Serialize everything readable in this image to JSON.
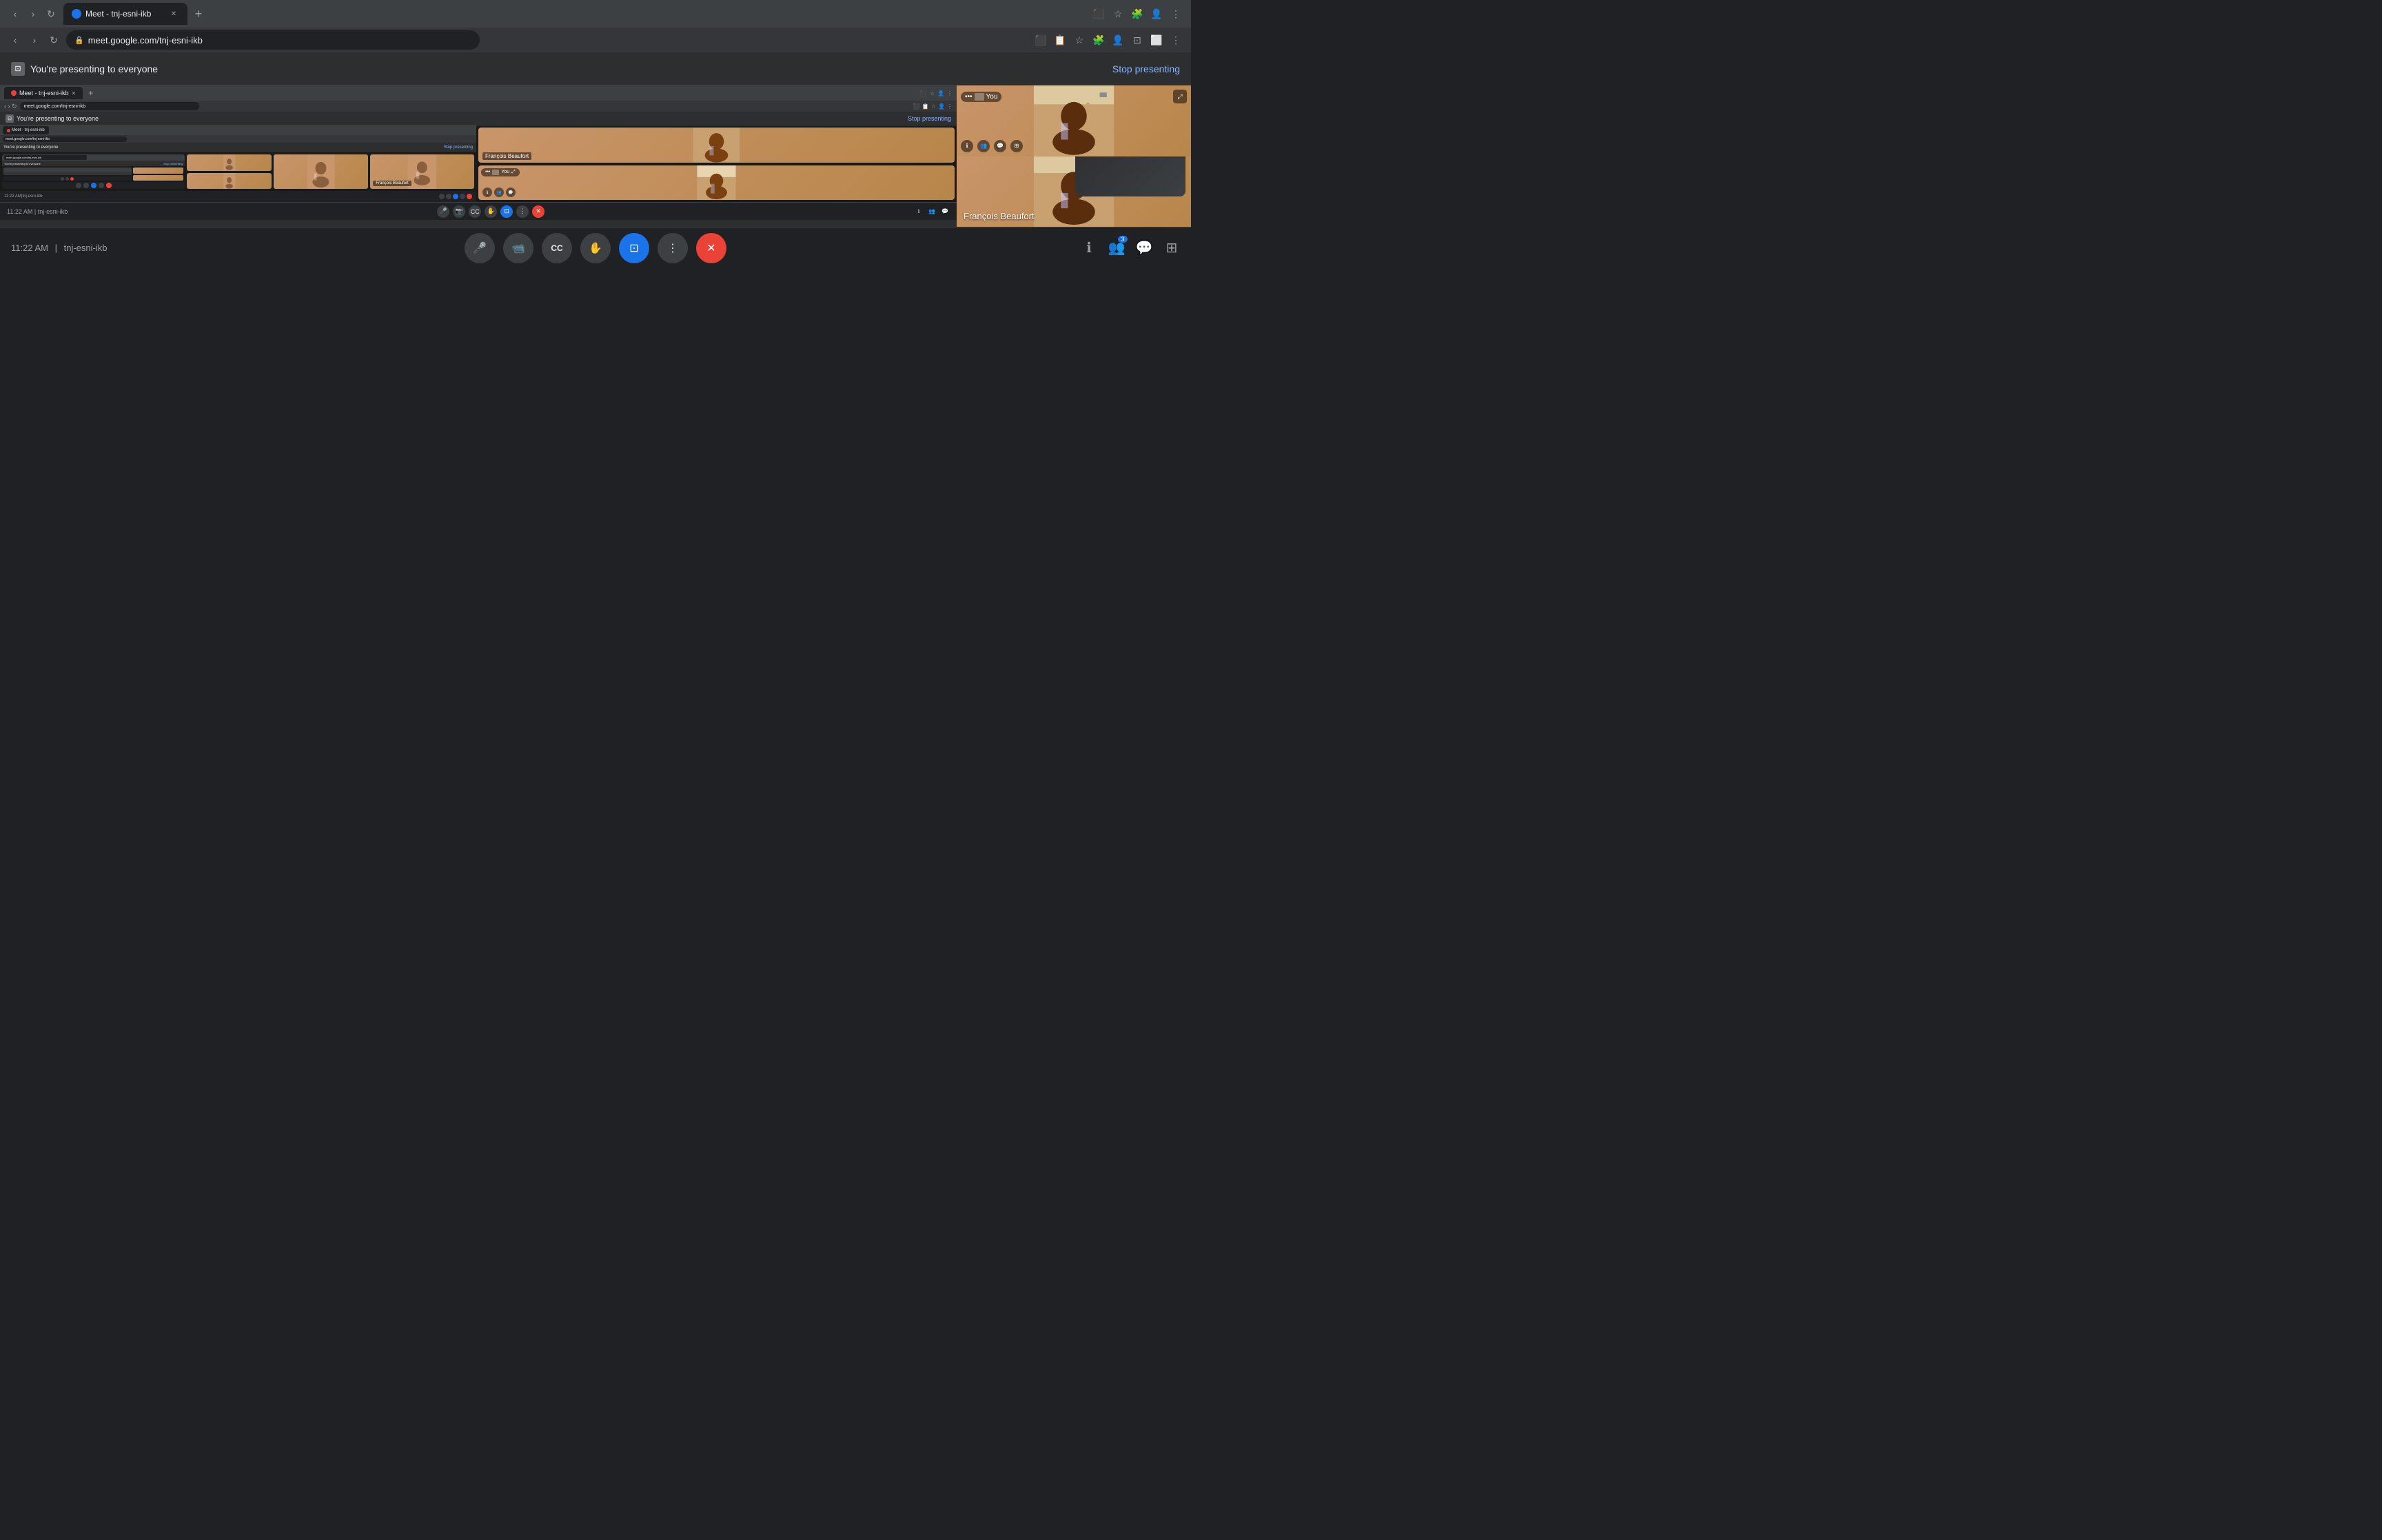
{
  "browser": {
    "tab_title": "Meet - tnj-esni-ikb",
    "tab_favicon": "●",
    "url": "meet.google.com/tnj-esni-ikb",
    "new_tab_label": "+",
    "close_tab_label": "✕"
  },
  "meet": {
    "presenting_notice": "You're presenting to everyone",
    "stop_presenting_label": "Stop presenting",
    "meeting_time": "11:22 AM",
    "meeting_code": "tnj-esni-ikb",
    "participant_name": "François Beaufort",
    "you_label": "You"
  },
  "controls": {
    "mic_label": "🎤",
    "camera_label": "📹",
    "captions_label": "CC",
    "raise_hand_label": "✋",
    "present_label": "⊡",
    "more_label": "⋮",
    "end_label": "✕"
  },
  "bottom_right": {
    "info_label": "ℹ",
    "people_label": "👥",
    "chat_label": "💬",
    "activities_label": "⊞"
  },
  "recursive": {
    "browser_tab": "Meet - tnj-esni-ikb",
    "url": "meet.google.com/tnj-esni-ikb",
    "presenting": "You're presenting to everyone",
    "stop": "Stop presenting"
  }
}
